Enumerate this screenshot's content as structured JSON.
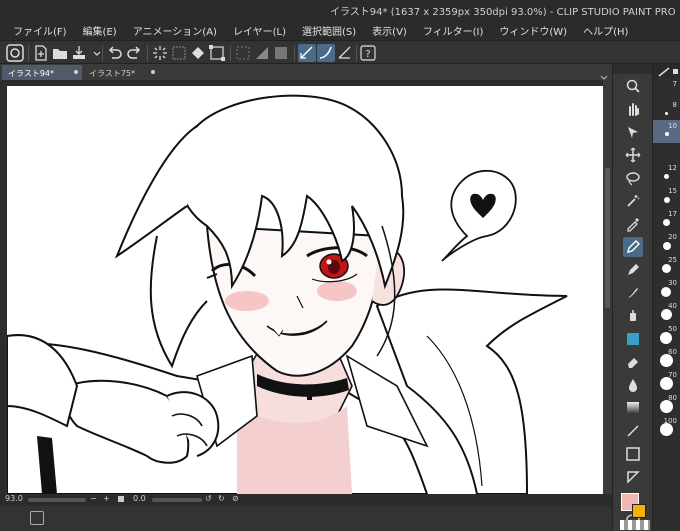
{
  "window": {
    "title": "イラスト94* (1637 x 2359px 350dpi 93.0%) - CLIP STUDIO PAINT PRO"
  },
  "menu": {
    "items": [
      "ファイル(F)",
      "編集(E)",
      "アニメーション(A)",
      "レイヤー(L)",
      "選択範囲(S)",
      "表示(V)",
      "フィルター(I)",
      "ウィンドウ(W)",
      "ヘルプ(H)"
    ]
  },
  "tabs": [
    {
      "label": "イラスト94*",
      "active": true
    },
    {
      "label": "イラスト75*",
      "active": false
    }
  ],
  "status": {
    "zoom": "93.0",
    "rotation": "0.0"
  },
  "tools": {
    "icons": [
      "magnifier-icon",
      "hand-icon",
      "operation-icon",
      "move-icon",
      "lasso-icon",
      "magic-wand-icon",
      "eyedropper-icon",
      "pen-icon",
      "pencil-icon",
      "brush-icon",
      "airbrush-icon",
      "eraser-icon",
      "fill-icon",
      "blend-icon",
      "gradient-icon",
      "figure-icon",
      "frame-icon",
      "ruler-icon",
      "text-icon",
      "balloon-icon"
    ]
  },
  "brush_sizes": {
    "labels": [
      "7",
      "8",
      "10",
      "12",
      "15",
      "17",
      "20",
      "25",
      "30",
      "40",
      "50",
      "60",
      "70",
      "80",
      "100"
    ],
    "active": "10"
  },
  "colors": {
    "main": "#f2b7b3",
    "sub": "#f0b400",
    "accent": "#5a6a84"
  }
}
